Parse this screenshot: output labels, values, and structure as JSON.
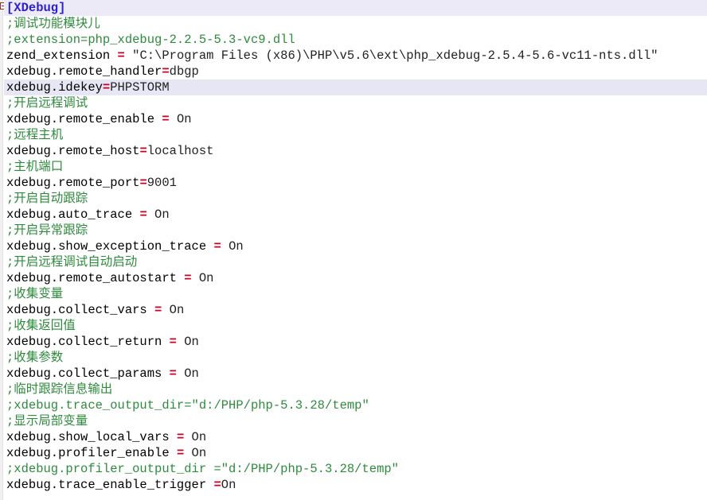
{
  "editor": {
    "file_type": "ini",
    "colors": {
      "background": "#ffffff",
      "text": "#000000",
      "comment": "#2e8b3c",
      "section_header": "#2f22c8",
      "equals": "#cc0022",
      "current_line_highlight": "#e6e6f5",
      "section_line_highlight": "#eceaf7",
      "gutter": "#f0f0f0"
    },
    "gutter": {
      "fold_marker": "collapse-box-icon"
    },
    "current_line_number": 6,
    "lines": [
      {
        "n": 1,
        "kind": "section",
        "highlight": "section",
        "tokens": [
          {
            "t": "section",
            "s": "[XDebug]"
          }
        ]
      },
      {
        "n": 2,
        "kind": "comment",
        "highlight": "none",
        "tokens": [
          {
            "t": "comment",
            "s": ";调试功能模块儿"
          }
        ]
      },
      {
        "n": 3,
        "kind": "comment",
        "highlight": "none",
        "tokens": [
          {
            "t": "comment",
            "s": ";extension=php_xdebug-2.2.5-5.3-vc9.dll"
          }
        ]
      },
      {
        "n": 4,
        "kind": "setting",
        "highlight": "none",
        "tokens": [
          {
            "t": "key",
            "s": "zend_extension "
          },
          {
            "t": "eq",
            "s": "="
          },
          {
            "t": "val",
            "s": " \"C:\\Program Files (x86)\\PHP\\v5.6\\ext\\php_xdebug-2.5.4-5.6-vc11-nts.dll\""
          }
        ]
      },
      {
        "n": 5,
        "kind": "setting",
        "highlight": "none",
        "tokens": [
          {
            "t": "key",
            "s": "xdebug.remote_handler"
          },
          {
            "t": "eq",
            "s": "="
          },
          {
            "t": "val",
            "s": "dbgp"
          }
        ]
      },
      {
        "n": 6,
        "kind": "setting",
        "highlight": "current",
        "tokens": [
          {
            "t": "key",
            "s": "xdebug.idekey"
          },
          {
            "t": "eq",
            "s": "="
          },
          {
            "t": "val",
            "s": "PHPSTORM"
          }
        ]
      },
      {
        "n": 7,
        "kind": "comment",
        "highlight": "none",
        "tokens": [
          {
            "t": "comment",
            "s": ";开启远程调试"
          }
        ]
      },
      {
        "n": 8,
        "kind": "setting",
        "highlight": "none",
        "tokens": [
          {
            "t": "key",
            "s": "xdebug.remote_enable "
          },
          {
            "t": "eq",
            "s": "="
          },
          {
            "t": "val",
            "s": " On"
          }
        ]
      },
      {
        "n": 9,
        "kind": "comment",
        "highlight": "none",
        "tokens": [
          {
            "t": "comment",
            "s": ";远程主机"
          }
        ]
      },
      {
        "n": 10,
        "kind": "setting",
        "highlight": "none",
        "tokens": [
          {
            "t": "key",
            "s": "xdebug.remote_host"
          },
          {
            "t": "eq",
            "s": "="
          },
          {
            "t": "val",
            "s": "localhost"
          }
        ]
      },
      {
        "n": 11,
        "kind": "comment",
        "highlight": "none",
        "tokens": [
          {
            "t": "comment",
            "s": ";主机端口"
          }
        ]
      },
      {
        "n": 12,
        "kind": "setting",
        "highlight": "none",
        "tokens": [
          {
            "t": "key",
            "s": "xdebug.remote_port"
          },
          {
            "t": "eq",
            "s": "="
          },
          {
            "t": "val",
            "s": "9001"
          }
        ]
      },
      {
        "n": 13,
        "kind": "comment",
        "highlight": "none",
        "tokens": [
          {
            "t": "comment",
            "s": ";开启自动跟踪"
          }
        ]
      },
      {
        "n": 14,
        "kind": "setting",
        "highlight": "none",
        "tokens": [
          {
            "t": "key",
            "s": "xdebug.auto_trace "
          },
          {
            "t": "eq",
            "s": "="
          },
          {
            "t": "val",
            "s": " On"
          }
        ]
      },
      {
        "n": 15,
        "kind": "comment",
        "highlight": "none",
        "tokens": [
          {
            "t": "comment",
            "s": ";开启异常跟踪"
          }
        ]
      },
      {
        "n": 16,
        "kind": "setting",
        "highlight": "none",
        "tokens": [
          {
            "t": "key",
            "s": "xdebug.show_exception_trace "
          },
          {
            "t": "eq",
            "s": "="
          },
          {
            "t": "val",
            "s": " On"
          }
        ]
      },
      {
        "n": 17,
        "kind": "comment",
        "highlight": "none",
        "tokens": [
          {
            "t": "comment",
            "s": ";开启远程调试自动启动"
          }
        ]
      },
      {
        "n": 18,
        "kind": "setting",
        "highlight": "none",
        "tokens": [
          {
            "t": "key",
            "s": "xdebug.remote_autostart "
          },
          {
            "t": "eq",
            "s": "="
          },
          {
            "t": "val",
            "s": " On"
          }
        ]
      },
      {
        "n": 19,
        "kind": "comment",
        "highlight": "none",
        "tokens": [
          {
            "t": "comment",
            "s": ";收集变量"
          }
        ]
      },
      {
        "n": 20,
        "kind": "setting",
        "highlight": "none",
        "tokens": [
          {
            "t": "key",
            "s": "xdebug.collect_vars "
          },
          {
            "t": "eq",
            "s": "="
          },
          {
            "t": "val",
            "s": " On"
          }
        ]
      },
      {
        "n": 21,
        "kind": "comment",
        "highlight": "none",
        "tokens": [
          {
            "t": "comment",
            "s": ";收集返回值"
          }
        ]
      },
      {
        "n": 22,
        "kind": "setting",
        "highlight": "none",
        "tokens": [
          {
            "t": "key",
            "s": "xdebug.collect_return "
          },
          {
            "t": "eq",
            "s": "="
          },
          {
            "t": "val",
            "s": " On"
          }
        ]
      },
      {
        "n": 23,
        "kind": "comment",
        "highlight": "none",
        "tokens": [
          {
            "t": "comment",
            "s": ";收集参数"
          }
        ]
      },
      {
        "n": 24,
        "kind": "setting",
        "highlight": "none",
        "tokens": [
          {
            "t": "key",
            "s": "xdebug.collect_params "
          },
          {
            "t": "eq",
            "s": "="
          },
          {
            "t": "val",
            "s": " On"
          }
        ]
      },
      {
        "n": 25,
        "kind": "comment",
        "highlight": "none",
        "tokens": [
          {
            "t": "comment",
            "s": ";临时跟踪信息输出"
          }
        ]
      },
      {
        "n": 26,
        "kind": "comment",
        "highlight": "none",
        "tokens": [
          {
            "t": "comment",
            "s": ";xdebug.trace_output_dir=\"d:/PHP/php-5.3.28/temp\""
          }
        ]
      },
      {
        "n": 27,
        "kind": "comment",
        "highlight": "none",
        "tokens": [
          {
            "t": "comment",
            "s": ";显示局部变量"
          }
        ]
      },
      {
        "n": 28,
        "kind": "setting",
        "highlight": "none",
        "tokens": [
          {
            "t": "key",
            "s": "xdebug.show_local_vars "
          },
          {
            "t": "eq",
            "s": "="
          },
          {
            "t": "val",
            "s": " On"
          }
        ]
      },
      {
        "n": 29,
        "kind": "setting",
        "highlight": "none",
        "tokens": [
          {
            "t": "key",
            "s": "xdebug.profiler_enable "
          },
          {
            "t": "eq",
            "s": "="
          },
          {
            "t": "val",
            "s": " On"
          }
        ]
      },
      {
        "n": 30,
        "kind": "comment",
        "highlight": "none",
        "tokens": [
          {
            "t": "comment",
            "s": ";xdebug.profiler_output_dir =\"d:/PHP/php-5.3.28/temp\""
          }
        ]
      },
      {
        "n": 31,
        "kind": "setting",
        "highlight": "none",
        "tokens": [
          {
            "t": "key",
            "s": "xdebug.trace_enable_trigger "
          },
          {
            "t": "eq",
            "s": "="
          },
          {
            "t": "val",
            "s": "On"
          }
        ]
      }
    ]
  }
}
